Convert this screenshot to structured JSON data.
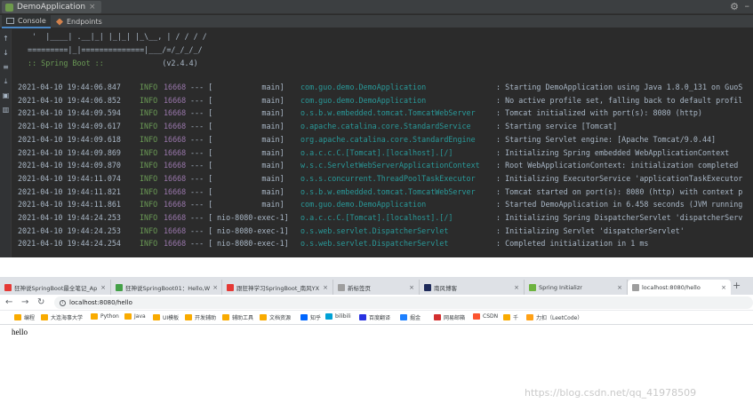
{
  "ide": {
    "run_tab_label": "DemoApplication",
    "subtabs": {
      "console": "Console",
      "endpoints": "Endpoints"
    },
    "banner": [
      "  '  |____| .__|_| |_|_| |_\\__, | / / / /",
      " =========|_|==============|___/=/_/_/_/"
    ],
    "boot_label": " :: Spring Boot :: ",
    "boot_version": "            (v2.4.4)",
    "log_lines": [
      {
        "ts": "2021-04-10 19:44:06.847",
        "level": "INFO",
        "pid": "16668",
        "sep": "--- [",
        "thread": "          main]",
        "logger": "com.guo.demo.DemoApplication",
        "msg": ": Starting DemoApplication using Java 1.8.0_131 on GuoS"
      },
      {
        "ts": "2021-04-10 19:44:06.852",
        "level": "INFO",
        "pid": "16668",
        "sep": "--- [",
        "thread": "          main]",
        "logger": "com.guo.demo.DemoApplication",
        "msg": ": No active profile set, falling back to default profil"
      },
      {
        "ts": "2021-04-10 19:44:09.594",
        "level": "INFO",
        "pid": "16668",
        "sep": "--- [",
        "thread": "          main]",
        "logger": "o.s.b.w.embedded.tomcat.TomcatWebServer",
        "msg": ": Tomcat initialized with port(s): 8080 (http)"
      },
      {
        "ts": "2021-04-10 19:44:09.617",
        "level": "INFO",
        "pid": "16668",
        "sep": "--- [",
        "thread": "          main]",
        "logger": "o.apache.catalina.core.StandardService",
        "msg": ": Starting service [Tomcat]"
      },
      {
        "ts": "2021-04-10 19:44:09.618",
        "level": "INFO",
        "pid": "16668",
        "sep": "--- [",
        "thread": "          main]",
        "logger": "org.apache.catalina.core.StandardEngine",
        "msg": ": Starting Servlet engine: [Apache Tomcat/9.0.44]"
      },
      {
        "ts": "2021-04-10 19:44:09.869",
        "level": "INFO",
        "pid": "16668",
        "sep": "--- [",
        "thread": "          main]",
        "logger": "o.a.c.c.C.[Tomcat].[localhost].[/]",
        "msg": ": Initializing Spring embedded WebApplicationContext"
      },
      {
        "ts": "2021-04-10 19:44:09.870",
        "level": "INFO",
        "pid": "16668",
        "sep": "--- [",
        "thread": "          main]",
        "logger": "w.s.c.ServletWebServerApplicationContext",
        "msg": ": Root WebApplicationContext: initialization completed"
      },
      {
        "ts": "2021-04-10 19:44:11.074",
        "level": "INFO",
        "pid": "16668",
        "sep": "--- [",
        "thread": "          main]",
        "logger": "o.s.s.concurrent.ThreadPoolTaskExecutor",
        "msg": ": Initializing ExecutorService 'applicationTaskExecutor"
      },
      {
        "ts": "2021-04-10 19:44:11.821",
        "level": "INFO",
        "pid": "16668",
        "sep": "--- [",
        "thread": "          main]",
        "logger": "o.s.b.w.embedded.tomcat.TomcatWebServer",
        "msg": ": Tomcat started on port(s): 8080 (http) with context p"
      },
      {
        "ts": "2021-04-10 19:44:11.861",
        "level": "INFO",
        "pid": "16668",
        "sep": "--- [",
        "thread": "          main]",
        "logger": "com.guo.demo.DemoApplication",
        "msg": ": Started DemoApplication in 6.458 seconds (JVM running"
      },
      {
        "ts": "2021-04-10 19:44:24.253",
        "level": "INFO",
        "pid": "16668",
        "sep": "--- [",
        "thread": "nio-8080-exec-1]",
        "logger": "o.a.c.c.C.[Tomcat].[localhost].[/]",
        "msg": ": Initializing Spring DispatcherServlet 'dispatcherServ"
      },
      {
        "ts": "2021-04-10 19:44:24.253",
        "level": "INFO",
        "pid": "16668",
        "sep": "--- [",
        "thread": "nio-8080-exec-1]",
        "logger": "o.s.web.servlet.DispatcherServlet",
        "msg": ": Initializing Servlet 'dispatcherServlet'"
      },
      {
        "ts": "2021-04-10 19:44:24.254",
        "level": "INFO",
        "pid": "16668",
        "sep": "--- [",
        "thread": "nio-8080-exec-1]",
        "logger": "o.s.web.servlet.DispatcherServlet",
        "msg": ": Completed initialization in 1 ms"
      }
    ]
  },
  "browser": {
    "tabs": [
      {
        "label": "狂神说SpringBoot最全笔记_Ap",
        "favicon_color": "#e53935"
      },
      {
        "label": "狂神说SpringBoot01：Hello,W",
        "favicon_color": "#43a047"
      },
      {
        "label": "跟狂神学习SpringBoot_南风YX",
        "favicon_color": "#e53935"
      },
      {
        "label": "新标签页",
        "favicon_color": "#9e9e9e"
      },
      {
        "label": "南风博客",
        "favicon_color": "#1e2a5a"
      },
      {
        "label": "Spring Initializr",
        "favicon_color": "#6db33f"
      },
      {
        "label": "localhost:8080/hello",
        "favicon_color": "#9e9e9e"
      }
    ],
    "url": "localhost:8080/hello",
    "bookmarks": [
      {
        "label": "编程",
        "color": "#f9ab00"
      },
      {
        "label": "大连海事大学",
        "color": "#f9ab00"
      },
      {
        "label": "Python",
        "color": "#f9ab00"
      },
      {
        "label": "Java",
        "color": "#f9ab00"
      },
      {
        "label": "UI模板",
        "color": "#f9ab00"
      },
      {
        "label": "开发辅助",
        "color": "#f9ab00"
      },
      {
        "label": "辅助工具",
        "color": "#f9ab00"
      },
      {
        "label": "文档资源",
        "color": "#f9ab00"
      },
      {
        "label": "知乎",
        "color": "#0066ff"
      },
      {
        "label": "bilibili",
        "color": "#00a1d6"
      },
      {
        "label": "百度翻译",
        "color": "#2932e1"
      },
      {
        "label": "掘金",
        "color": "#1e80ff"
      },
      {
        "label": "网易邮箱",
        "color": "#d32f2f"
      },
      {
        "label": "CSDN",
        "color": "#fc5531"
      },
      {
        "label": "千",
        "color": "#f9ab00"
      },
      {
        "label": "力扣（LeetCode）",
        "color": "#ffa116"
      }
    ],
    "page_text": "hello"
  },
  "watermark": "https://blog.csdn.net/qq_41978509"
}
